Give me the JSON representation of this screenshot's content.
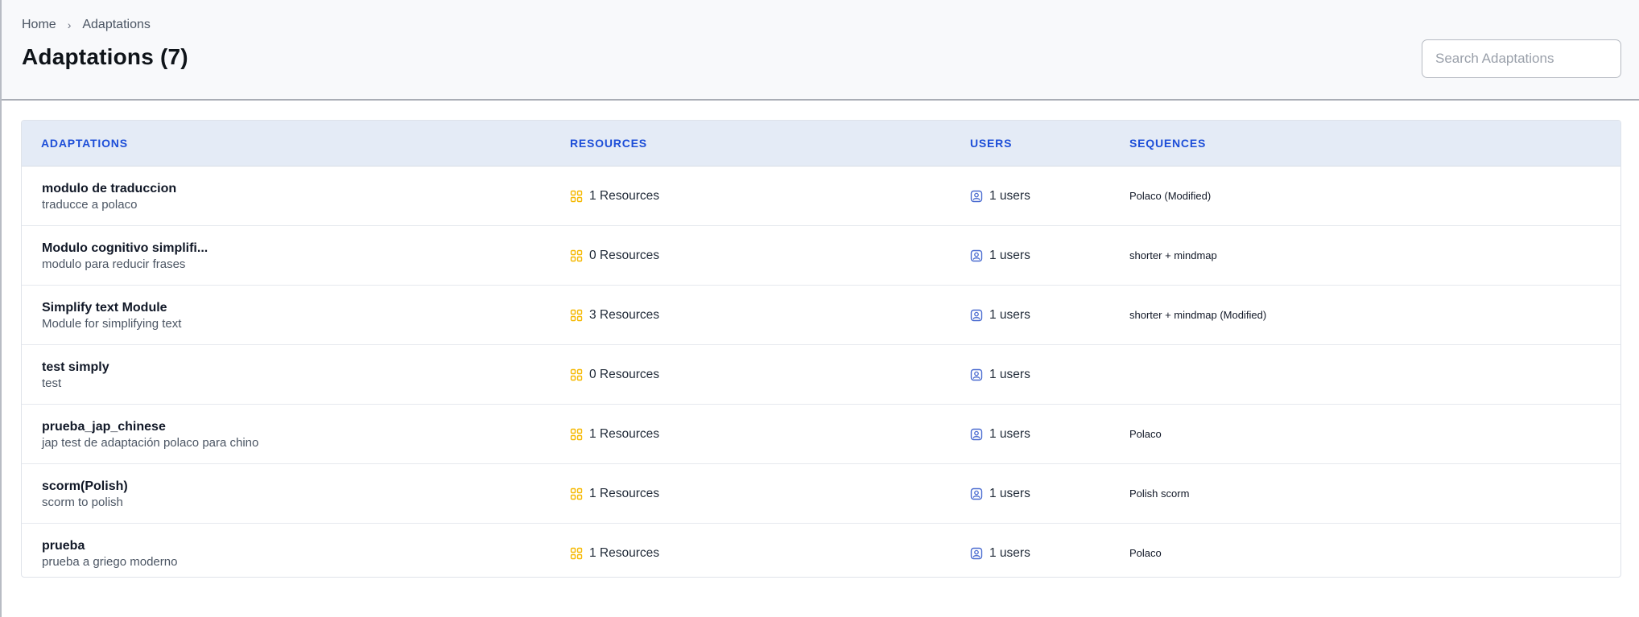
{
  "breadcrumb": {
    "home": "Home",
    "current": "Adaptations"
  },
  "page": {
    "title": "Adaptations (7)"
  },
  "search": {
    "placeholder": "Search Adaptations",
    "value": ""
  },
  "table": {
    "headers": {
      "adaptations": "ADAPTATIONS",
      "resources": "RESOURCES",
      "users": "USERS",
      "sequences": "SEQUENCES"
    },
    "rows": [
      {
        "name": "modulo de traduccion",
        "description": "traducce a polaco",
        "resources": "1 Resources",
        "users": "1 users",
        "sequence": "Polaco (Modified)"
      },
      {
        "name": "Modulo cognitivo simplifi...",
        "description": "modulo para reducir frases",
        "resources": "0 Resources",
        "users": "1 users",
        "sequence": "shorter + mindmap"
      },
      {
        "name": "Simplify text Module",
        "description": "Module for simplifying text",
        "resources": "3 Resources",
        "users": "1 users",
        "sequence": "shorter + mindmap (Modified)"
      },
      {
        "name": "test simply",
        "description": "test",
        "resources": "0 Resources",
        "users": "1 users",
        "sequence": ""
      },
      {
        "name": "prueba_jap_chinese",
        "description": "jap test de adaptación polaco para chino",
        "resources": "1 Resources",
        "users": "1 users",
        "sequence": "Polaco"
      },
      {
        "name": "scorm(Polish)",
        "description": "scorm to polish",
        "resources": "1 Resources",
        "users": "1 users",
        "sequence": "Polish scorm"
      },
      {
        "name": "prueba",
        "description": "prueba a griego moderno",
        "resources": "1 Resources",
        "users": "1 users",
        "sequence": "Polaco"
      }
    ]
  },
  "icons": {
    "resources": "grid-icon",
    "users": "user-badge-icon"
  },
  "colors": {
    "accent": "#1d4ed8",
    "header_bg": "#e4ebf6",
    "resource_icon": "#f5b800",
    "user_icon": "#4a6bd0"
  }
}
